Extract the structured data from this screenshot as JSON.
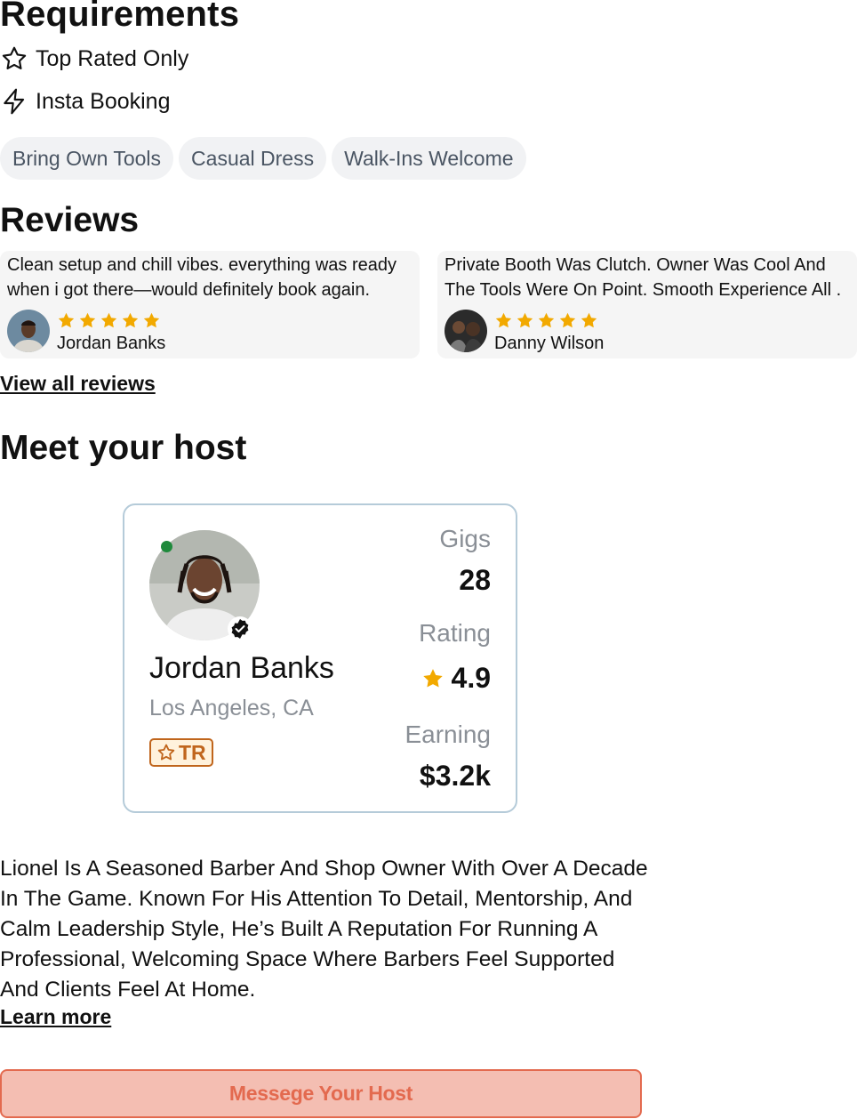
{
  "requirements": {
    "title": "Requirements",
    "items": [
      {
        "icon": "star-outline-icon",
        "label": "Top Rated Only"
      },
      {
        "icon": "lightning-icon",
        "label": "Insta Booking"
      }
    ],
    "chips": [
      "Bring Own Tools",
      "Casual Dress",
      "Walk-Ins Welcome"
    ]
  },
  "reviews": {
    "title": "Reviews",
    "items": [
      {
        "text": "Clean setup and chill vibes. everything was ready when i got there—would definitely book again.",
        "stars": 5,
        "name": "Jordan Banks"
      },
      {
        "text": "Private Booth Was Clutch. Owner Was Cool And The Tools Were On Point. Smooth Experience All .",
        "stars": 5,
        "name": "Danny Wilson"
      }
    ],
    "view_all": "View all reviews"
  },
  "host": {
    "title": "Meet your host",
    "name": "Jordan Banks",
    "location": "Los Angeles, CA",
    "badge": "TR",
    "online": true,
    "verified": true,
    "stats": {
      "gigs_label": "Gigs",
      "gigs_value": "28",
      "rating_label": "Rating",
      "rating_value": "4.9",
      "earning_label": "Earning",
      "earning_value": "$3.2k"
    },
    "bio": "Lionel Is A Seasoned Barber And Shop Owner With Over A Decade In The Game. Known For His Attention To Detail, Mentorship, And Calm Leadership Style, He’s Built A Reputation For Running A Professional, Welcoming Space Where Barbers Feel Supported And Clients Feel At Home.",
    "learn_more": "Learn more",
    "cta": "Messege Your Host"
  },
  "colors": {
    "star": "#f2a900",
    "chip_bg": "#f1f2f4",
    "cta_bg": "#f4beb2",
    "cta_border": "#e36a4f",
    "card_border": "#b5cbd9",
    "online": "#1f8a3c",
    "badge": "#c0651c"
  }
}
